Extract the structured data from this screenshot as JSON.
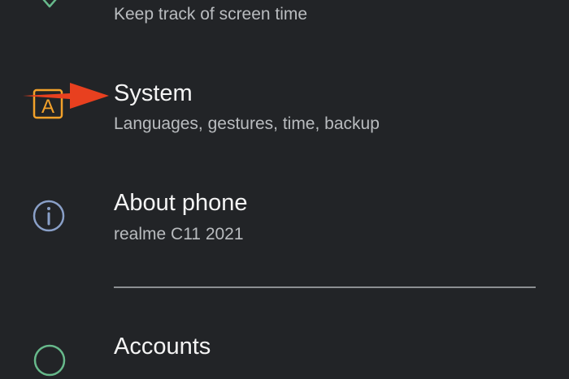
{
  "settings": {
    "items": [
      {
        "title": "",
        "subtitle": "Keep track of screen time",
        "icon": "heart-icon",
        "icon_color": "#67b98b"
      },
      {
        "title": "System",
        "subtitle": "Languages, gestures, time, backup",
        "icon": "system-language-icon",
        "icon_color": "#f3a12a"
      },
      {
        "title": "About phone",
        "subtitle": "realme C11 2021",
        "icon": "info-icon",
        "icon_color": "#8aa0c8"
      },
      {
        "title": "Accounts",
        "subtitle": "",
        "icon": "accounts-icon",
        "icon_color": "#67b98b"
      }
    ]
  },
  "system_icon_letter": "A",
  "annotation": {
    "arrow_color": "#e8401f"
  },
  "theme": {
    "background": "#222427",
    "title_color": "#f4f4f4",
    "subtitle_color": "#b9bcbf",
    "divider_color": "#8c8f92"
  }
}
